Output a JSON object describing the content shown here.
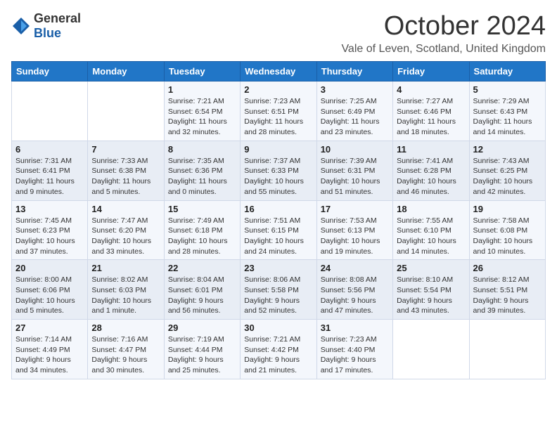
{
  "logo": {
    "general": "General",
    "blue": "Blue"
  },
  "title": "October 2024",
  "location": "Vale of Leven, Scotland, United Kingdom",
  "headers": [
    "Sunday",
    "Monday",
    "Tuesday",
    "Wednesday",
    "Thursday",
    "Friday",
    "Saturday"
  ],
  "weeks": [
    [
      {
        "day": "",
        "sunrise": "",
        "sunset": "",
        "daylight": ""
      },
      {
        "day": "",
        "sunrise": "",
        "sunset": "",
        "daylight": ""
      },
      {
        "day": "1",
        "sunrise": "Sunrise: 7:21 AM",
        "sunset": "Sunset: 6:54 PM",
        "daylight": "Daylight: 11 hours and 32 minutes."
      },
      {
        "day": "2",
        "sunrise": "Sunrise: 7:23 AM",
        "sunset": "Sunset: 6:51 PM",
        "daylight": "Daylight: 11 hours and 28 minutes."
      },
      {
        "day": "3",
        "sunrise": "Sunrise: 7:25 AM",
        "sunset": "Sunset: 6:49 PM",
        "daylight": "Daylight: 11 hours and 23 minutes."
      },
      {
        "day": "4",
        "sunrise": "Sunrise: 7:27 AM",
        "sunset": "Sunset: 6:46 PM",
        "daylight": "Daylight: 11 hours and 18 minutes."
      },
      {
        "day": "5",
        "sunrise": "Sunrise: 7:29 AM",
        "sunset": "Sunset: 6:43 PM",
        "daylight": "Daylight: 11 hours and 14 minutes."
      }
    ],
    [
      {
        "day": "6",
        "sunrise": "Sunrise: 7:31 AM",
        "sunset": "Sunset: 6:41 PM",
        "daylight": "Daylight: 11 hours and 9 minutes."
      },
      {
        "day": "7",
        "sunrise": "Sunrise: 7:33 AM",
        "sunset": "Sunset: 6:38 PM",
        "daylight": "Daylight: 11 hours and 5 minutes."
      },
      {
        "day": "8",
        "sunrise": "Sunrise: 7:35 AM",
        "sunset": "Sunset: 6:36 PM",
        "daylight": "Daylight: 11 hours and 0 minutes."
      },
      {
        "day": "9",
        "sunrise": "Sunrise: 7:37 AM",
        "sunset": "Sunset: 6:33 PM",
        "daylight": "Daylight: 10 hours and 55 minutes."
      },
      {
        "day": "10",
        "sunrise": "Sunrise: 7:39 AM",
        "sunset": "Sunset: 6:31 PM",
        "daylight": "Daylight: 10 hours and 51 minutes."
      },
      {
        "day": "11",
        "sunrise": "Sunrise: 7:41 AM",
        "sunset": "Sunset: 6:28 PM",
        "daylight": "Daylight: 10 hours and 46 minutes."
      },
      {
        "day": "12",
        "sunrise": "Sunrise: 7:43 AM",
        "sunset": "Sunset: 6:25 PM",
        "daylight": "Daylight: 10 hours and 42 minutes."
      }
    ],
    [
      {
        "day": "13",
        "sunrise": "Sunrise: 7:45 AM",
        "sunset": "Sunset: 6:23 PM",
        "daylight": "Daylight: 10 hours and 37 minutes."
      },
      {
        "day": "14",
        "sunrise": "Sunrise: 7:47 AM",
        "sunset": "Sunset: 6:20 PM",
        "daylight": "Daylight: 10 hours and 33 minutes."
      },
      {
        "day": "15",
        "sunrise": "Sunrise: 7:49 AM",
        "sunset": "Sunset: 6:18 PM",
        "daylight": "Daylight: 10 hours and 28 minutes."
      },
      {
        "day": "16",
        "sunrise": "Sunrise: 7:51 AM",
        "sunset": "Sunset: 6:15 PM",
        "daylight": "Daylight: 10 hours and 24 minutes."
      },
      {
        "day": "17",
        "sunrise": "Sunrise: 7:53 AM",
        "sunset": "Sunset: 6:13 PM",
        "daylight": "Daylight: 10 hours and 19 minutes."
      },
      {
        "day": "18",
        "sunrise": "Sunrise: 7:55 AM",
        "sunset": "Sunset: 6:10 PM",
        "daylight": "Daylight: 10 hours and 14 minutes."
      },
      {
        "day": "19",
        "sunrise": "Sunrise: 7:58 AM",
        "sunset": "Sunset: 6:08 PM",
        "daylight": "Daylight: 10 hours and 10 minutes."
      }
    ],
    [
      {
        "day": "20",
        "sunrise": "Sunrise: 8:00 AM",
        "sunset": "Sunset: 6:06 PM",
        "daylight": "Daylight: 10 hours and 5 minutes."
      },
      {
        "day": "21",
        "sunrise": "Sunrise: 8:02 AM",
        "sunset": "Sunset: 6:03 PM",
        "daylight": "Daylight: 10 hours and 1 minute."
      },
      {
        "day": "22",
        "sunrise": "Sunrise: 8:04 AM",
        "sunset": "Sunset: 6:01 PM",
        "daylight": "Daylight: 9 hours and 56 minutes."
      },
      {
        "day": "23",
        "sunrise": "Sunrise: 8:06 AM",
        "sunset": "Sunset: 5:58 PM",
        "daylight": "Daylight: 9 hours and 52 minutes."
      },
      {
        "day": "24",
        "sunrise": "Sunrise: 8:08 AM",
        "sunset": "Sunset: 5:56 PM",
        "daylight": "Daylight: 9 hours and 47 minutes."
      },
      {
        "day": "25",
        "sunrise": "Sunrise: 8:10 AM",
        "sunset": "Sunset: 5:54 PM",
        "daylight": "Daylight: 9 hours and 43 minutes."
      },
      {
        "day": "26",
        "sunrise": "Sunrise: 8:12 AM",
        "sunset": "Sunset: 5:51 PM",
        "daylight": "Daylight: 9 hours and 39 minutes."
      }
    ],
    [
      {
        "day": "27",
        "sunrise": "Sunrise: 7:14 AM",
        "sunset": "Sunset: 4:49 PM",
        "daylight": "Daylight: 9 hours and 34 minutes."
      },
      {
        "day": "28",
        "sunrise": "Sunrise: 7:16 AM",
        "sunset": "Sunset: 4:47 PM",
        "daylight": "Daylight: 9 hours and 30 minutes."
      },
      {
        "day": "29",
        "sunrise": "Sunrise: 7:19 AM",
        "sunset": "Sunset: 4:44 PM",
        "daylight": "Daylight: 9 hours and 25 minutes."
      },
      {
        "day": "30",
        "sunrise": "Sunrise: 7:21 AM",
        "sunset": "Sunset: 4:42 PM",
        "daylight": "Daylight: 9 hours and 21 minutes."
      },
      {
        "day": "31",
        "sunrise": "Sunrise: 7:23 AM",
        "sunset": "Sunset: 4:40 PM",
        "daylight": "Daylight: 9 hours and 17 minutes."
      },
      {
        "day": "",
        "sunrise": "",
        "sunset": "",
        "daylight": ""
      },
      {
        "day": "",
        "sunrise": "",
        "sunset": "",
        "daylight": ""
      }
    ]
  ]
}
